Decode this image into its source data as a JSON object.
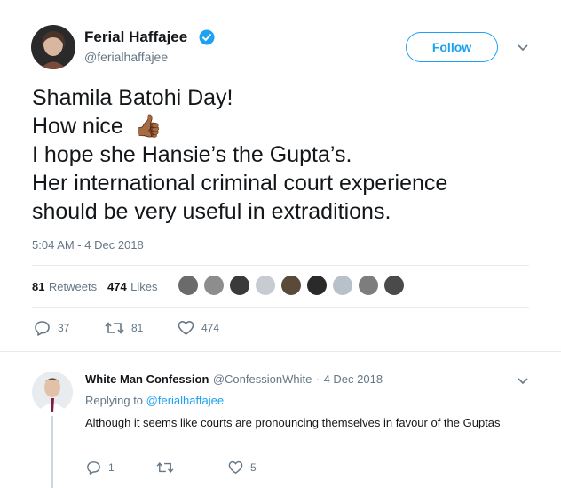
{
  "author": {
    "name": "Ferial Haffajee",
    "handle": "@ferialhaffajee",
    "verified_icon": "verified-badge-icon"
  },
  "follow_label": "Follow",
  "tweet": {
    "lines": [
      "Shamila Batohi Day!",
      "How nice",
      "I hope she Hansie’s the Gupta’s.",
      "Her international criminal court experience",
      "should be very useful in extraditions."
    ],
    "emoji": "👍🏾",
    "timestamp": "5:04 AM - 4 Dec 2018"
  },
  "stats": {
    "retweets_count": "81",
    "retweets_label": "Retweets",
    "likes_count": "474",
    "likes_label": "Likes"
  },
  "actions": {
    "reply_count": "37",
    "retweet_count": "81",
    "like_count": "474"
  },
  "reply": {
    "name": "White Man Confession",
    "handle": "@ConfessionWhite",
    "separator": "·",
    "date": "4 Dec 2018",
    "replying_to_label": "Replying to",
    "replying_to_handle": "@ferialhaffajee",
    "text": "Although it seems like courts are pronouncing themselves in favour of the Guptas",
    "reply_count": "1",
    "retweet_count": "",
    "like_count": "5"
  },
  "colors": {
    "accent": "#1da1f2",
    "secondary_text": "#657786",
    "divider": "#e6ecf0"
  }
}
